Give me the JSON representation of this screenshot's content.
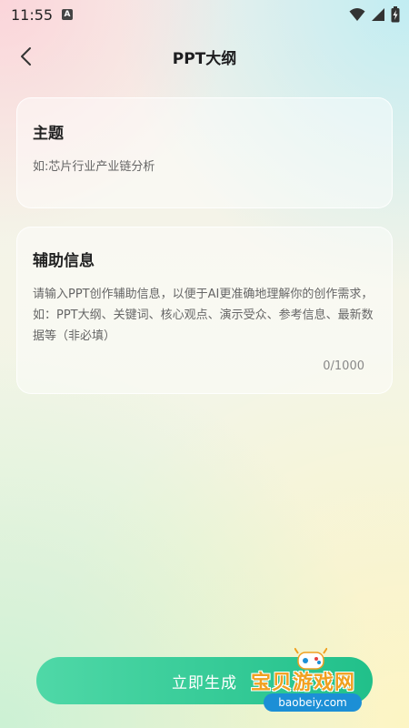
{
  "status_bar": {
    "time": "11:55",
    "notification_letter": "A",
    "icons": [
      "wifi-icon",
      "signal-icon",
      "battery-icon"
    ]
  },
  "header": {
    "back_icon": "chevron-left-icon",
    "title": "PPT大纲"
  },
  "topic_card": {
    "label": "主题",
    "value": "",
    "placeholder": "如:芯片行业产业链分析"
  },
  "info_card": {
    "label": "辅助信息",
    "value": "",
    "placeholder": "请输入PPT创作辅助信息，以便于AI更准确地理解你的创作需求，如：PPT大纲、关键词、核心观点、演示受众、参考信息、最新数据等（非必填）",
    "char_count": "0/1000"
  },
  "footer": {
    "generate_label": "立即生成"
  },
  "watermark": {
    "text": "宝贝游戏网",
    "url": "baobeiy.com"
  },
  "colors": {
    "button_start": "#4fd8a7",
    "button_end": "#21c08a",
    "watermark_orange": "#f0a020",
    "watermark_blue": "#1c8fd6"
  }
}
